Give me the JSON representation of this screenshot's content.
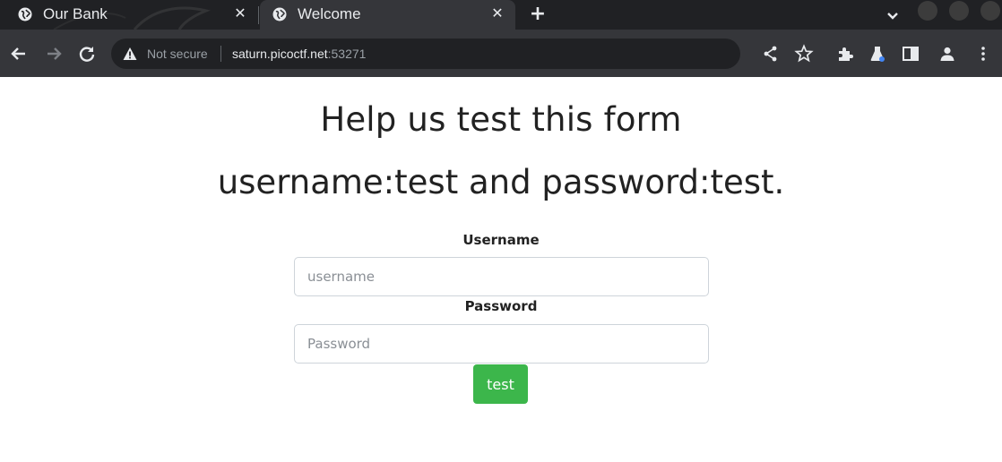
{
  "browser": {
    "tabs": [
      {
        "title": "Our Bank",
        "icon": "globe-icon",
        "active": false
      },
      {
        "title": "Welcome",
        "icon": "globe-icon",
        "active": true
      }
    ],
    "tab_close_glyph": "✕",
    "new_tab_glyph": "+",
    "security_label": "Not secure",
    "url_host": "saturn.picoctf.net",
    "url_port": ":53271"
  },
  "page": {
    "heading": "Help us test this form",
    "subheading": "username:test and password:test.",
    "username_label": "Username",
    "username_placeholder": "username",
    "password_label": "Password",
    "password_placeholder": "Password",
    "submit_label": "test",
    "submit_color": "#3cb64b"
  }
}
